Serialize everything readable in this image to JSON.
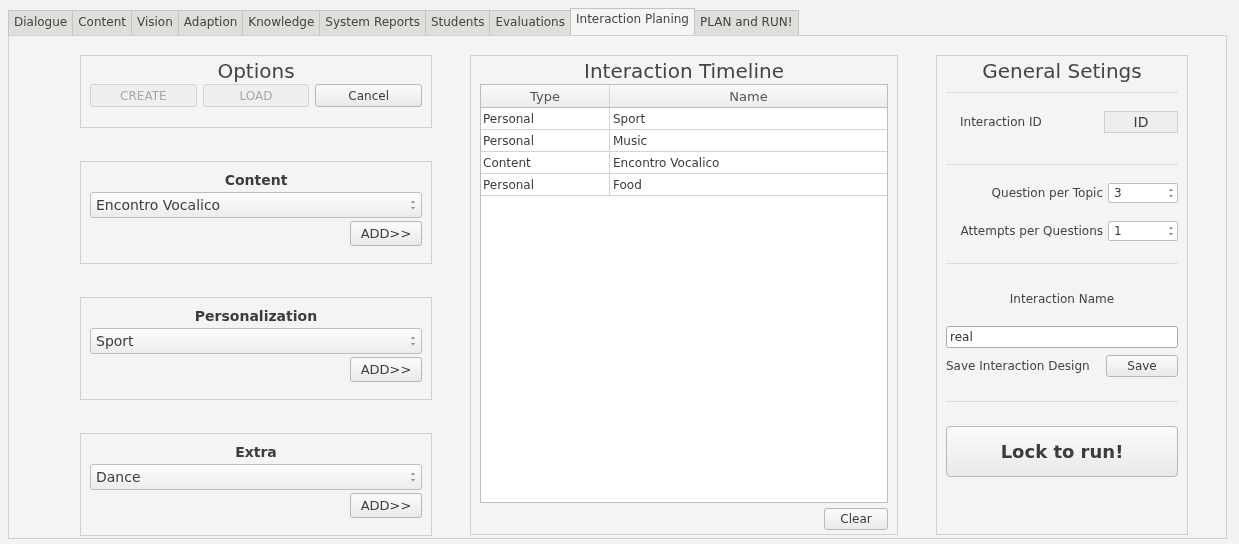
{
  "tabs": [
    {
      "label": "Dialogue",
      "selected": false
    },
    {
      "label": "Content",
      "selected": false
    },
    {
      "label": "Vision",
      "selected": false
    },
    {
      "label": "Adaption",
      "selected": false
    },
    {
      "label": "Knowledge",
      "selected": false
    },
    {
      "label": "System Reports",
      "selected": false
    },
    {
      "label": "Students",
      "selected": false
    },
    {
      "label": "Evaluations",
      "selected": false
    },
    {
      "label": "Interaction Planing",
      "selected": true
    },
    {
      "label": "PLAN and RUN!",
      "selected": false
    }
  ],
  "options": {
    "title": "Options",
    "buttons": [
      {
        "label": "CREATE",
        "disabled": true
      },
      {
        "label": "LOAD",
        "disabled": true
      },
      {
        "label": "Cancel",
        "disabled": false
      }
    ]
  },
  "pickers": [
    {
      "title": "Content",
      "value": "Encontro Vocalico",
      "button": "ADD>>"
    },
    {
      "title": "Personalization",
      "value": "Sport",
      "button": "ADD>>"
    },
    {
      "title": "Extra",
      "value": "Dance",
      "button": "ADD>>"
    }
  ],
  "timeline": {
    "title": "Interaction Timeline",
    "columns": [
      "Type",
      "Name"
    ],
    "rows": [
      [
        "Personal",
        "Sport"
      ],
      [
        "Personal",
        "Music"
      ],
      [
        "Content",
        "Encontro Vocalico"
      ],
      [
        "Personal",
        "Food"
      ]
    ],
    "clear_button": "Clear"
  },
  "settings": {
    "title": "General Setings",
    "id_label": "Interaction ID",
    "id_value": "ID",
    "spinners": [
      {
        "label": "Question per  Topic",
        "value": "3"
      },
      {
        "label": "Attempts per Questions",
        "value": "1"
      }
    ],
    "name_label": "Interaction Name",
    "name_value": "real",
    "save_label": "Save Interaction Design",
    "save_button": "Save",
    "lock_button": "Lock to run!"
  }
}
